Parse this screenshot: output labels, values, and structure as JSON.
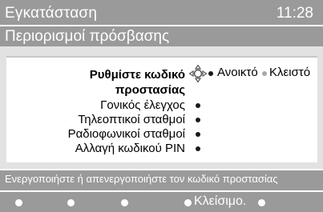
{
  "header": {
    "title": "Εγκατάσταση",
    "clock": "11:28",
    "subtitle": "Περιορισμοί πρόσβασης"
  },
  "menu": {
    "items": [
      {
        "label_line1": "Ρυθμίστε κωδικό",
        "label_line2": "προστασίας",
        "selected": true
      },
      {
        "label": "Γονικός έλεγχος"
      },
      {
        "label": "Τηλεοπτικοί σταθμοί"
      },
      {
        "label": "Ραδιοφωνικοί σταθμοί"
      },
      {
        "label": "Αλλαγή κωδικού PIN"
      }
    ],
    "navigator_icon": "four-way-navigation-icon"
  },
  "options": [
    {
      "label": "Ανοικτό",
      "active": true
    },
    {
      "label": "Κλειστό",
      "active": false
    }
  ],
  "footer": {
    "hint": "Ενεργοποιήστε ή απενεργοποιήστε τον κωδικό προστασίας",
    "close_label": "Κλείσιμο."
  },
  "colors": {
    "bar_gray": "#9a9a9a",
    "background": "#e2e2e2",
    "panel": "#ffffff",
    "text_white": "#ffffff",
    "text_black": "#000000"
  }
}
